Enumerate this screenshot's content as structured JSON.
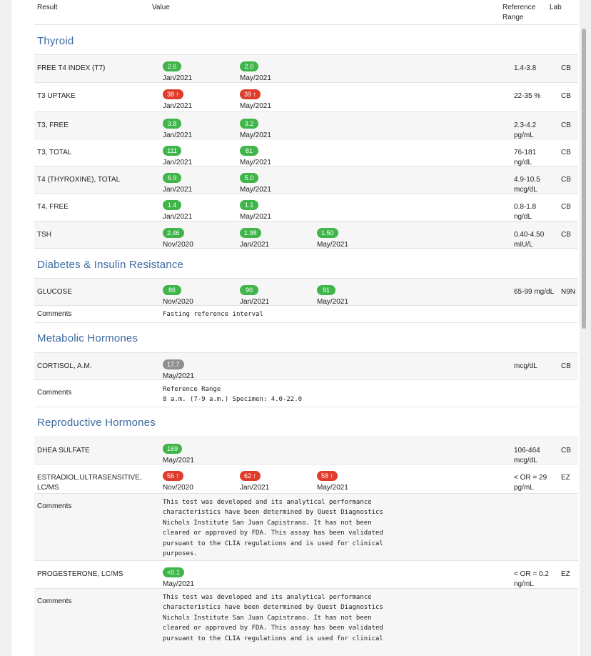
{
  "header": {
    "result": "Result",
    "value": "Value",
    "ref_line1": "Reference",
    "ref_line2": "Range",
    "lab": "Lab"
  },
  "sections": {
    "thyroid": "Thyroid",
    "diabetes": "Diabetes & Insulin Resistance",
    "metabolic": "Metabolic Hormones",
    "reproductive": "Reproductive Hormones"
  },
  "comments_label": "Comments",
  "rows": {
    "ft4i": {
      "name": "FREE T4 INDEX (T7)",
      "ref1": "1.4-3.8",
      "ref2": "",
      "lab": "CB",
      "r": [
        {
          "v": "2.6",
          "d": "Jan/2021",
          "s": "normal"
        },
        {
          "v": "2.0",
          "d": "May/2021",
          "s": "normal"
        }
      ]
    },
    "t3u": {
      "name": "T3 UPTAKE",
      "ref1": "22-35 %",
      "ref2": "",
      "lab": "CB",
      "r": [
        {
          "v": "38",
          "d": "Jan/2021",
          "s": "high"
        },
        {
          "v": "39",
          "d": "May/2021",
          "s": "high"
        }
      ]
    },
    "t3f": {
      "name": "T3, FREE",
      "ref1": "2.3-4.2",
      "ref2": "pg/mL",
      "lab": "CB",
      "r": [
        {
          "v": "3.8",
          "d": "Jan/2021",
          "s": "normal"
        },
        {
          "v": "3.2",
          "d": "May/2021",
          "s": "normal"
        }
      ]
    },
    "t3t": {
      "name": "T3, TOTAL",
      "ref1": "76-181",
      "ref2": "ng/dL",
      "lab": "CB",
      "r": [
        {
          "v": "111",
          "d": "Jan/2021",
          "s": "normal"
        },
        {
          "v": "81",
          "d": "May/2021",
          "s": "normal"
        }
      ]
    },
    "t4t": {
      "name": "T4 (THYROXINE), TOTAL",
      "ref1": "4.9-10.5",
      "ref2": "mcg/dL",
      "lab": "CB",
      "r": [
        {
          "v": "6.9",
          "d": "Jan/2021",
          "s": "normal"
        },
        {
          "v": "5.0",
          "d": "May/2021",
          "s": "normal"
        }
      ]
    },
    "t4f": {
      "name": "T4, FREE",
      "ref1": "0.8-1.8",
      "ref2": "ng/dL",
      "lab": "CB",
      "r": [
        {
          "v": "1.4",
          "d": "Jan/2021",
          "s": "normal"
        },
        {
          "v": "1.1",
          "d": "May/2021",
          "s": "normal"
        }
      ]
    },
    "tsh": {
      "name": "TSH",
      "ref1": "0.40-4.50",
      "ref2": "mIU/L",
      "lab": "CB",
      "r": [
        {
          "v": "2.46",
          "d": "Nov/2020",
          "s": "normal"
        },
        {
          "v": "1.98",
          "d": "Jan/2021",
          "s": "normal"
        },
        {
          "v": "1.50",
          "d": "May/2021",
          "s": "normal"
        }
      ]
    },
    "glu": {
      "name": "GLUCOSE",
      "ref1": "65-99 mg/dL",
      "ref2": "",
      "lab": "N9N",
      "r": [
        {
          "v": "86",
          "d": "Nov/2020",
          "s": "normal"
        },
        {
          "v": "90",
          "d": "Jan/2021",
          "s": "normal"
        },
        {
          "v": "91",
          "d": "May/2021",
          "s": "normal"
        }
      ]
    },
    "cort": {
      "name": "CORTISOL, A.M.",
      "ref1": "mcg/dL",
      "ref2": "",
      "lab": "CB",
      "r": [
        {
          "v": "17.7",
          "d": "May/2021",
          "s": "neutral"
        }
      ]
    },
    "dhea": {
      "name": "DHEA SULFATE",
      "ref1": "106-464",
      "ref2": "mcg/dL",
      "lab": "CB",
      "r": [
        {
          "v": "169",
          "d": "May/2021",
          "s": "normal"
        }
      ]
    },
    "estr": {
      "name": "ESTRADIOL,ULTRASENSITIVE, LC/MS",
      "ref1": "< OR = 29",
      "ref2": "pg/mL",
      "lab": "EZ",
      "r": [
        {
          "v": "56",
          "d": "Nov/2020",
          "s": "high"
        },
        {
          "v": "62",
          "d": "Jan/2021",
          "s": "high"
        },
        {
          "v": "58",
          "d": "May/2021",
          "s": "high"
        }
      ]
    },
    "prog": {
      "name": "PROGESTERONE, LC/MS",
      "ref1": "< OR = 0.2",
      "ref2": "ng/mL",
      "lab": "EZ",
      "r": [
        {
          "v": "<0.1",
          "d": "May/2021",
          "s": "normal"
        }
      ]
    }
  },
  "comments": {
    "glu": "Fasting reference interval",
    "cort": "Reference Range\n8 a.m. (7-9 a.m.) Specimen: 4.0-22.0",
    "estr": "This test was developed and its analytical performance\ncharacteristics have been determined by Quest Diagnostics\nNichols Institute San Juan Capistrano. It has not been\ncleared or approved by FDA. This assay has been validated\npursuant to the CLIA regulations and is used for clinical\npurposes.",
    "prog": "This test was developed and its analytical performance\ncharacteristics have been determined by Quest Diagnostics\nNichols Institute San Juan Capistrano. It has not been\ncleared or approved by FDA. This assay has been validated\npursuant to the CLIA regulations and is used for clinical"
  },
  "icons": {
    "high_flag": "up-arrow-icon"
  },
  "colors": {
    "normal": "#3fb54a",
    "high": "#e03c2b",
    "neutral": "#8f8f8f",
    "section_title": "#3b6aa0"
  }
}
